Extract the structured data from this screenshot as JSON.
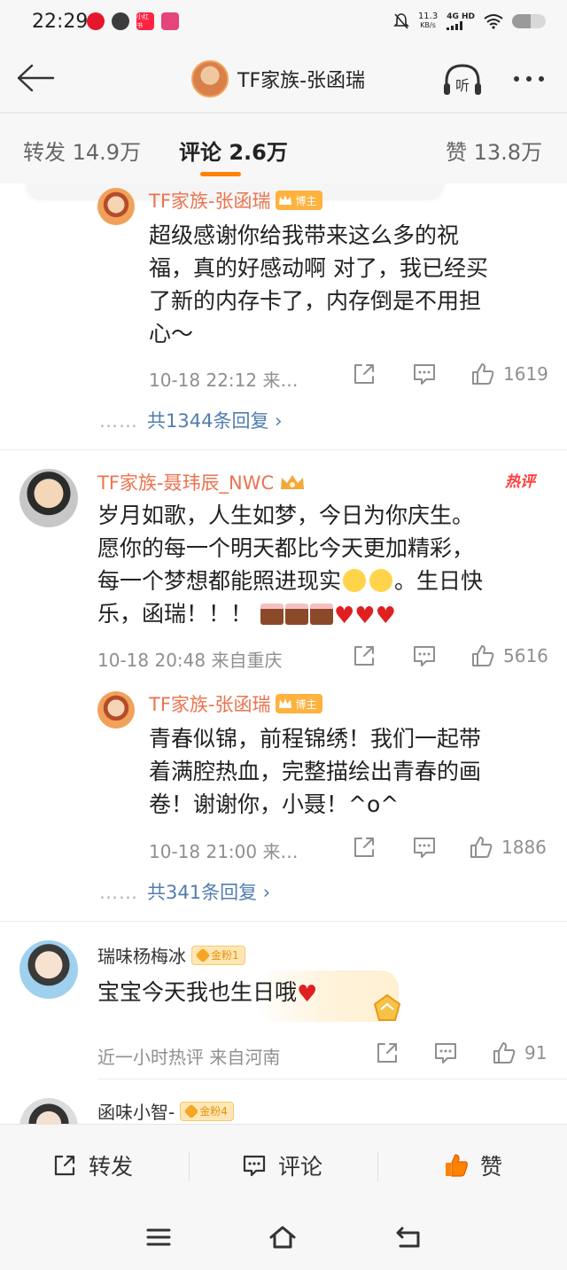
{
  "status_bar": {
    "time": "22:29",
    "net_speed_value": "11.3",
    "net_speed_unit": "KB/s",
    "network": "4G HD",
    "battery_level": 0.55,
    "apps": [
      {
        "name": "weibo-app-icon",
        "color": "#e6162d",
        "label": ""
      },
      {
        "name": "wechat-app-icon",
        "color": "#3c3c3c",
        "label": ""
      },
      {
        "name": "xiaohongshu-app-icon",
        "color": "#ff2442",
        "label": "小红书"
      },
      {
        "name": "other-app-icon",
        "color": "#e4457a",
        "label": ""
      }
    ]
  },
  "header": {
    "title": "TF家族-张函瑞",
    "listen_label": "听"
  },
  "tabs": {
    "repost": "转发 14.9万",
    "comment": "评论 2.6万",
    "like": "赞 13.8万"
  },
  "colors": {
    "accent": "#ff8200",
    "username": "#eb7350",
    "link": "#507daf",
    "hot": "#ff3d3d"
  },
  "comments": [
    {
      "author": "TF家族-张函瑞",
      "badge": "博主",
      "text_lines": [
        "超级感谢你给我带来这么多的祝",
        "福，真的好感动啊 对了，我已经买",
        "了新的内存卡了，内存倒是不用担",
        "心～"
      ],
      "date": "10-18 22:12",
      "location": "来…",
      "likes": "1619",
      "replies": "共1344条回复 ›"
    },
    {
      "author": "TF家族-聂玮辰_NWC",
      "hot_label": "热评",
      "text_lines": [
        "岁月如歌，人生如梦，今日为你庆生。",
        "愿你的每一个明天都比今天更加精彩，",
        "每一个梦想都能照进现实",
        "。生日快",
        "乐，函瑞！！！"
      ],
      "date": "10-18 20:48",
      "location": "来自重庆",
      "likes": "5616"
    },
    {
      "author": "TF家族-张函瑞",
      "badge": "博主",
      "text_lines": [
        "青春似锦，前程锦绣！我们一起带",
        "着满腔热血，完整描绘出青春的画",
        "卷！谢谢你，小聂！^o^"
      ],
      "date": "10-18 21:00",
      "location": "来…",
      "likes": "1886",
      "replies": "共341条回复 ›"
    },
    {
      "author": "瑞味杨梅冰",
      "fan_badge": "金粉1",
      "text": "宝宝今天我也生日哦",
      "date": "近一小时热评",
      "location": "来自河南",
      "likes": "91"
    },
    {
      "author": "函味小智-",
      "fan_badge": "金粉4"
    }
  ],
  "bottom_bar": {
    "repost": "转发",
    "comment": "评论",
    "like": "赞"
  },
  "reply_dots": "……"
}
